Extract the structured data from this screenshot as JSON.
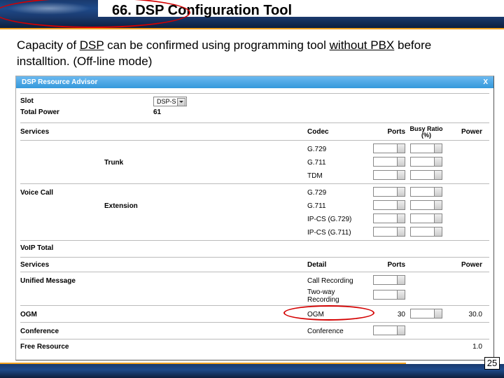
{
  "slide": {
    "title": "66. DSP Configuration Tool",
    "page_number": "25"
  },
  "body_text": {
    "p1a": "Capacity of ",
    "p1u": "DSP",
    "p1b": " can be confirmed using programming tool ",
    "p1c": "without PBX",
    "p1d": " before installtion. (Off-line mode)"
  },
  "tool": {
    "title": "DSP Resource Advisor",
    "close": "X",
    "top": {
      "slot": {
        "label": "Slot",
        "value": "DSP-S"
      },
      "total": {
        "label": "Total Power",
        "value": "61"
      }
    },
    "headers": {
      "services": "Services",
      "codec": "Codec",
      "ports": "Ports",
      "busy": "Busy Ratio (%)",
      "power": "Power",
      "detail": "Detail"
    },
    "section1": {
      "trunk": {
        "label": "Trunk",
        "codecs": [
          "G.729",
          "G.711",
          "TDM"
        ]
      },
      "voice": {
        "label": "Voice Call"
      },
      "ext": {
        "label": "Extension",
        "codecs": [
          "G.729",
          "G.711",
          "IP-CS (G.729)",
          "IP-CS (G.711)"
        ]
      },
      "voip": {
        "label": "VoIP Total"
      }
    },
    "section2": {
      "um": {
        "label": "Unified Message",
        "details": [
          "Call Recording",
          "Two-way Recording"
        ]
      },
      "ogm": {
        "label": "OGM",
        "detail": "OGM",
        "ports": "30",
        "power": "30.0"
      },
      "conf": {
        "label": "Conference",
        "detail": "Conference"
      },
      "free": {
        "label": "Free Resource",
        "power": "1.0"
      }
    }
  }
}
